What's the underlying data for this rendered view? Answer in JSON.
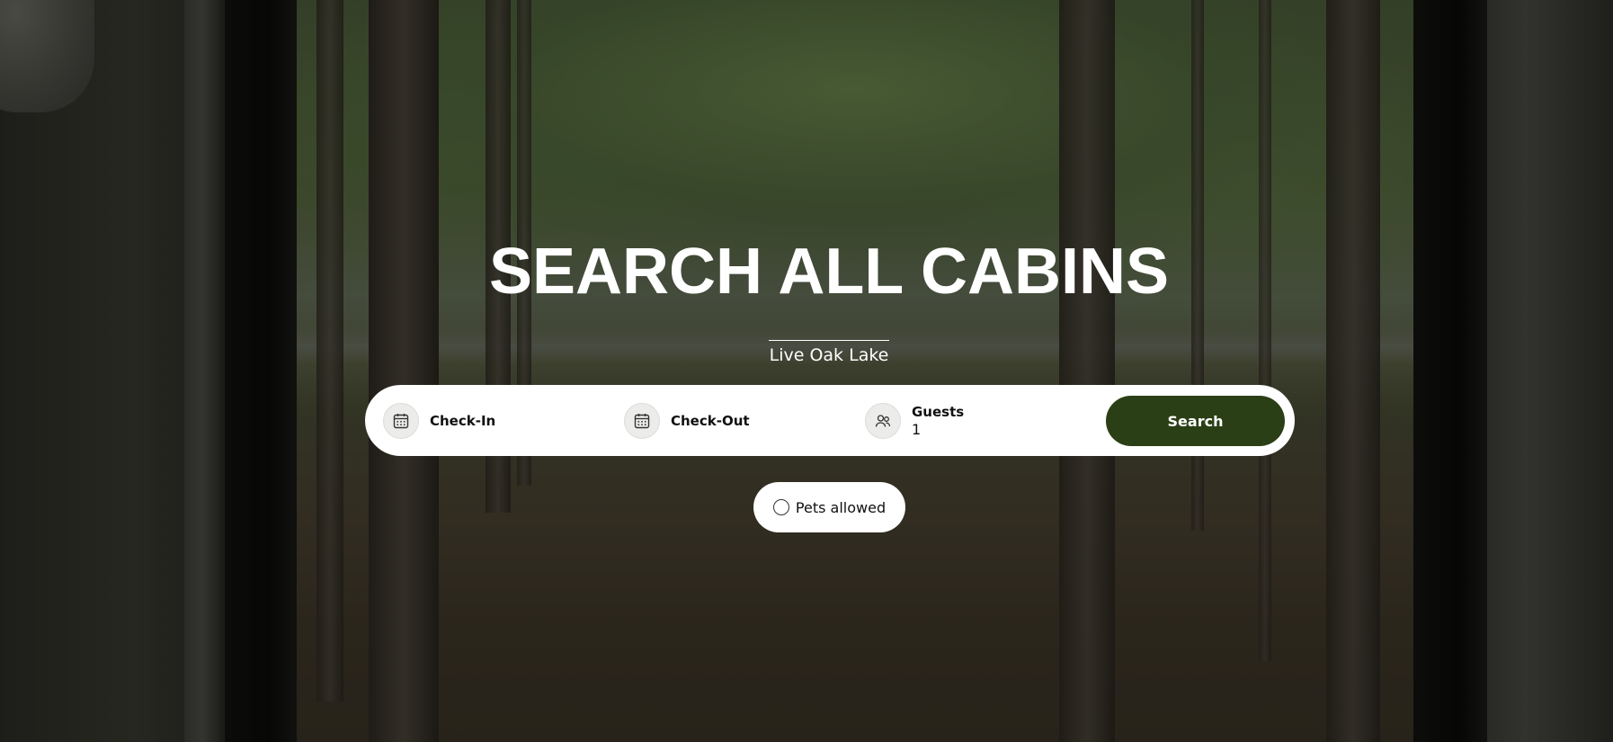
{
  "hero": {
    "title": "SEARCH ALL CABINS",
    "subtitle": "Live Oak Lake"
  },
  "search_bar": {
    "check_in": {
      "label": "Check-In",
      "icon": "calendar-icon"
    },
    "check_out": {
      "label": "Check-Out",
      "icon": "calendar-icon"
    },
    "guests": {
      "label": "Guests",
      "value": "1",
      "icon": "guests-icon"
    },
    "search_button": {
      "label": "Search"
    }
  },
  "filters": {
    "pets": {
      "label": "Pets allowed",
      "checked": false
    }
  },
  "colors": {
    "accent": "#2b3f17",
    "text_on_hero": "#ffffff",
    "icon_circle_bg": "#ececea"
  }
}
